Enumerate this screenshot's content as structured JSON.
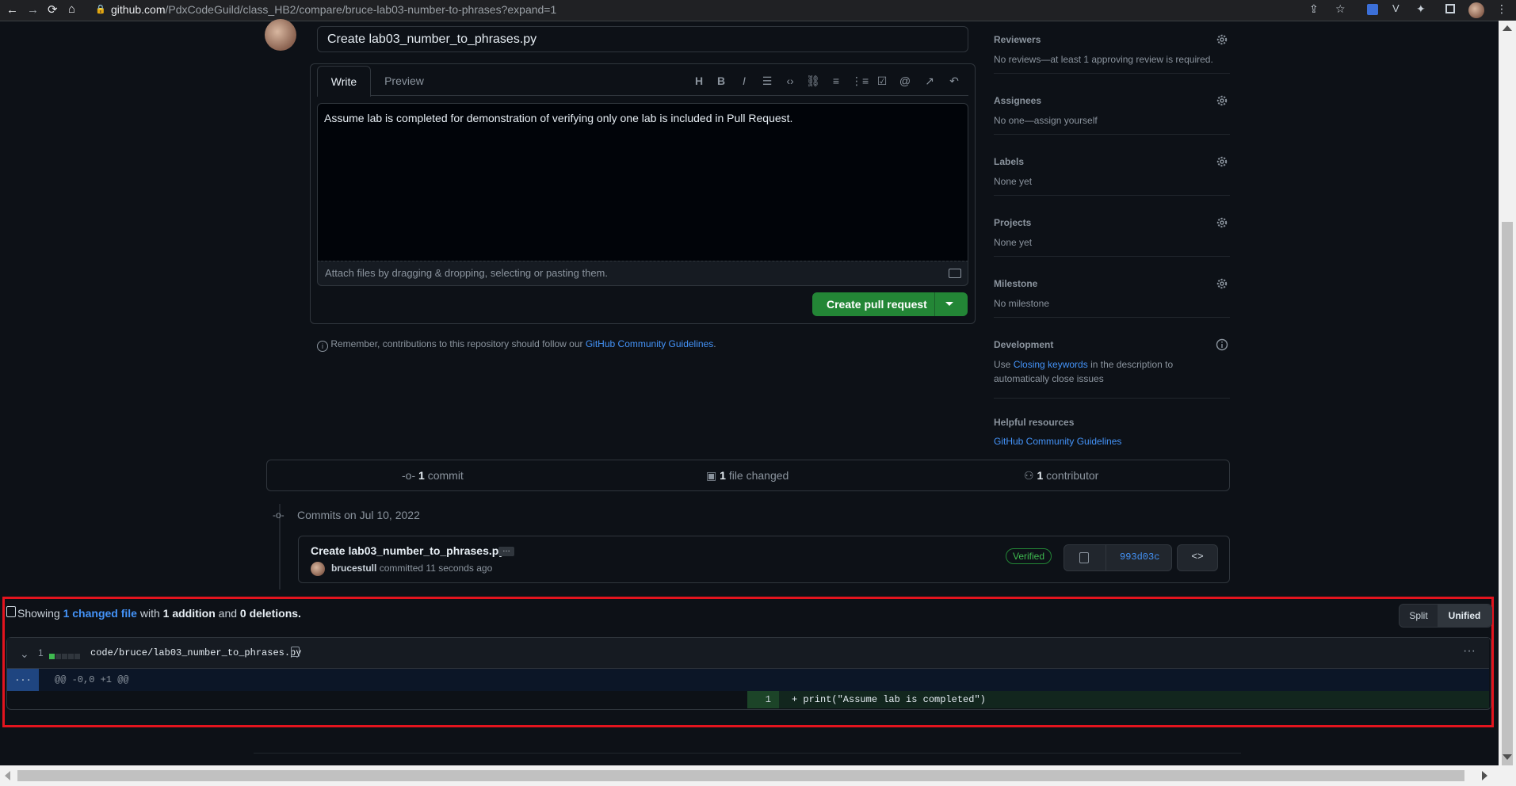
{
  "browser": {
    "url_host": "github.com",
    "url_path": "/PdxCodeGuild/class_HB2/compare/bruce-lab03-number-to-phrases?expand=1"
  },
  "pr_form": {
    "title_value": "Create lab03_number_to_phrases.py",
    "tab_write": "Write",
    "tab_preview": "Preview",
    "body_text": "Assume lab is completed for demonstration of verifying only one lab is included in Pull Request.",
    "attach_hint": "Attach files by dragging & dropping, selecting or pasting them.",
    "create_button": "Create pull request",
    "reminder_prefix": "Remember, contributions to this repository should follow our",
    "reminder_link": "GitHub Community Guidelines",
    "reminder_suffix": "."
  },
  "sidebar": {
    "reviewers": {
      "heading": "Reviewers",
      "value": "No reviews—at least 1 approving review is required."
    },
    "assignees": {
      "heading": "Assignees",
      "value": "No one—assign yourself"
    },
    "labels": {
      "heading": "Labels",
      "value": "None yet"
    },
    "projects": {
      "heading": "Projects",
      "value": "None yet"
    },
    "milestone": {
      "heading": "Milestone",
      "value": "No milestone"
    },
    "development": {
      "heading": "Development",
      "pre": "Use",
      "link": "Closing keywords",
      "post": "in the description to",
      "line2": "automatically close issues"
    },
    "helpful": {
      "heading": "Helpful resources",
      "link": "GitHub Community Guidelines"
    }
  },
  "stats": {
    "commits_count": "1",
    "commits_label": "commit",
    "files_count": "1",
    "files_label": "file changed",
    "contributors_count": "1",
    "contributors_label": "contributor"
  },
  "commits": {
    "date_heading": "Commits on Jul 10, 2022",
    "items": [
      {
        "title": "Create lab03_number_to_phrases.py",
        "ellipsis": "…",
        "author": "brucestull",
        "action": "committed",
        "time": "11 seconds ago",
        "badge": "Verified",
        "sha": "993d03c",
        "browse": "<>"
      }
    ]
  },
  "diff": {
    "showing_prefix": "Showing",
    "changed_link": "1 changed file",
    "with": "with",
    "additions": "1 addition",
    "and": "and",
    "deletions": "0 deletions.",
    "split_label": "Split",
    "unified_label": "Unified",
    "file": {
      "change_count": "1",
      "diffstat": {
        "added": 1,
        "neutral": 4
      },
      "path": "code/bruce/lab03_number_to_phrases.py",
      "hunk_expander": "...",
      "hunk_header": "@@ -0,0 +1 @@",
      "lines": [
        {
          "number": "1",
          "text": "+ print(\"Assume lab is completed\")"
        }
      ]
    }
  },
  "colors": {
    "background": "#0d1117",
    "accent_green": "#238636",
    "link_blue": "#4493f8",
    "highlight_red": "#e3141e"
  }
}
